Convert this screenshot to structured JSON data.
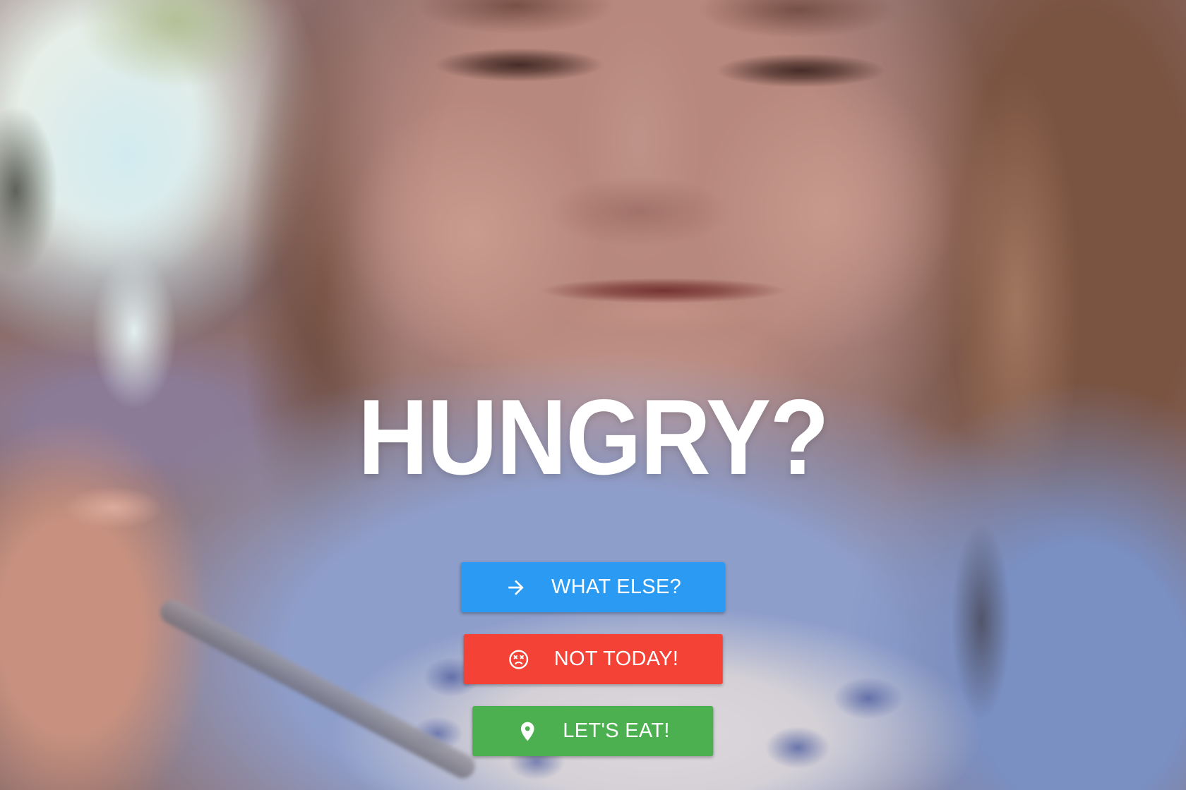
{
  "page": {
    "heading": "HUNGRY?"
  },
  "buttons": [
    {
      "label": "WHAT ELSE?",
      "icon": "arrow-right-icon",
      "color": "#2b9af3"
    },
    {
      "label": "NOT TODAY!",
      "icon": "dizzy-face-icon",
      "color": "#f44336"
    },
    {
      "label": "LET'S EAT!",
      "icon": "map-pin-icon",
      "color": "#4caf50"
    }
  ],
  "colors": {
    "heading": "#ffffff",
    "button_text": "#ffffff"
  }
}
